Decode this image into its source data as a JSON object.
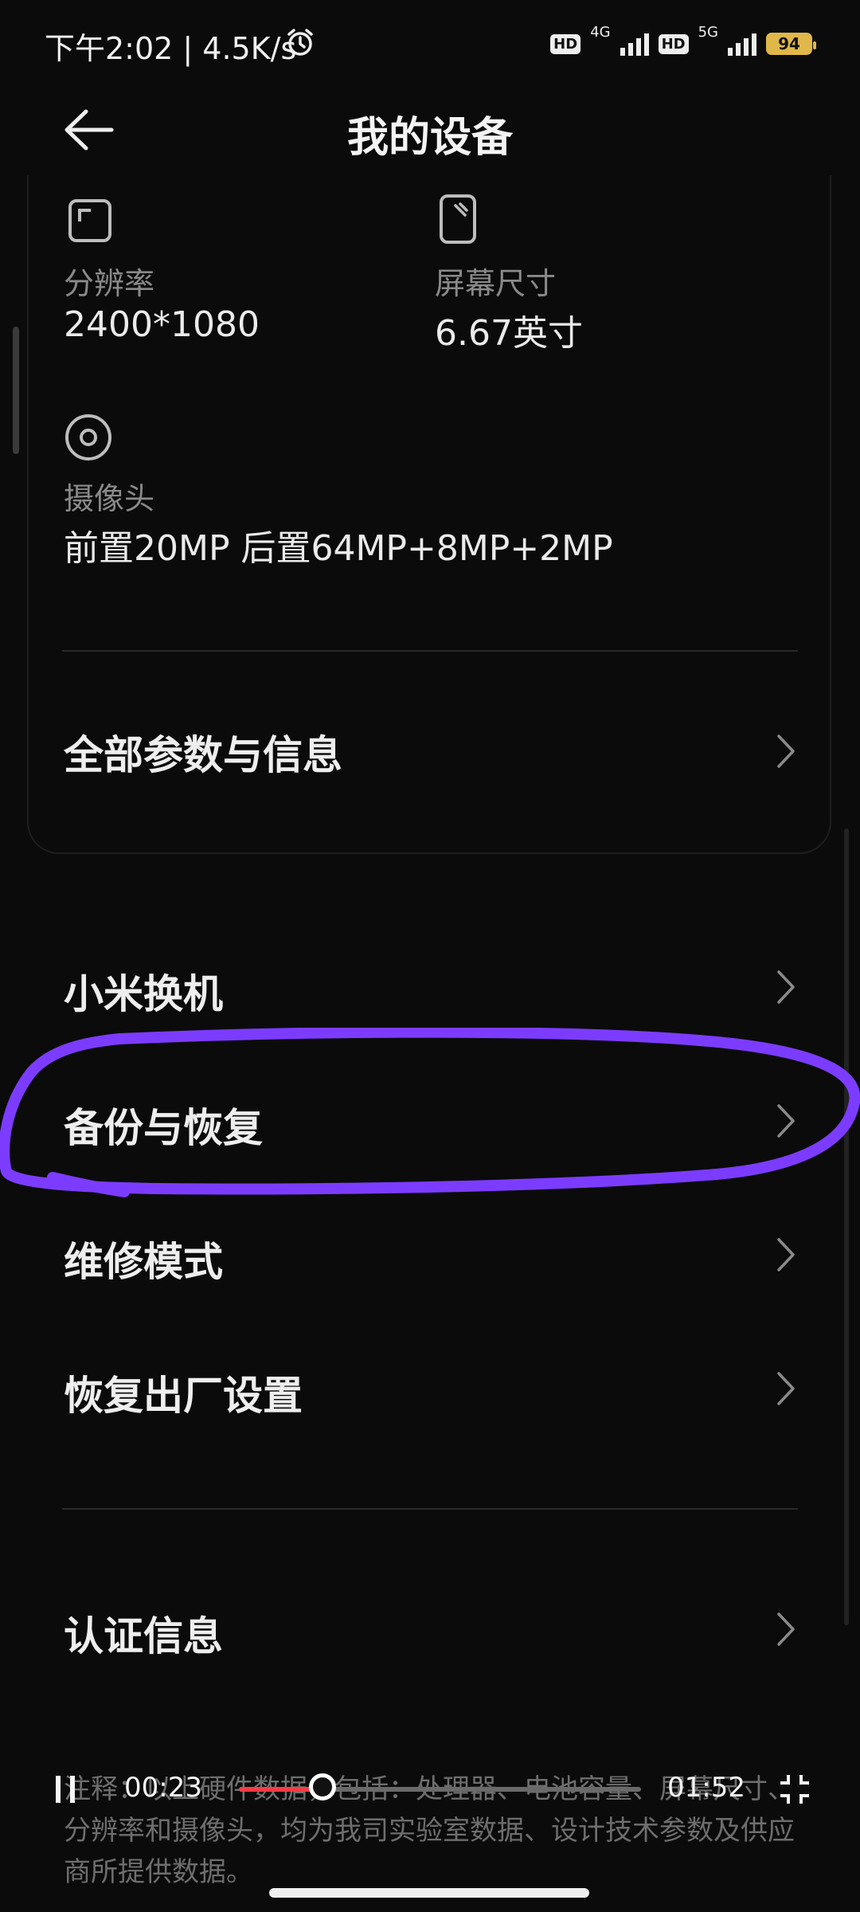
{
  "status_bar": {
    "time_speed": "下午2:02 | 4.5K/s",
    "hd1": "HD",
    "net1": "4G",
    "hd2": "HD",
    "net2": "5G",
    "battery": "94"
  },
  "header": {
    "title": "我的设备",
    "back_icon": "back-arrow-icon"
  },
  "specs": [
    {
      "icon": "resolution-icon",
      "label": "分辨率",
      "value": "2400*1080"
    },
    {
      "icon": "screen-size-icon",
      "label": "屏幕尺寸",
      "value": "6.67英寸"
    },
    {
      "icon": "camera-icon",
      "label": "摄像头",
      "value": "前置20MP 后置64MP+8MP+2MP"
    }
  ],
  "card_link": {
    "label": "全部参数与信息"
  },
  "menu": [
    {
      "label": "小米换机"
    },
    {
      "label": "备份与恢复"
    },
    {
      "label": "维修模式"
    },
    {
      "label": "恢复出厂设置"
    },
    {
      "label": "认证信息"
    }
  ],
  "footnote": "注释：以上硬件数据，包括：处理器、电池容量、屏幕尺寸、分辨率和摄像头，均为我司实验室数据、设计技术参数及供应商所提供数据。",
  "player": {
    "current": "00:23",
    "total": "01:52",
    "progress": 0.2,
    "pause_icon": "pause-icon",
    "exit_fullscreen_icon": "exit-fullscreen-icon"
  },
  "colors": {
    "background": "#0b0b0b",
    "annotation": "#7c3cff",
    "progress": "#ff3b45",
    "battery": "#e0b84a"
  }
}
